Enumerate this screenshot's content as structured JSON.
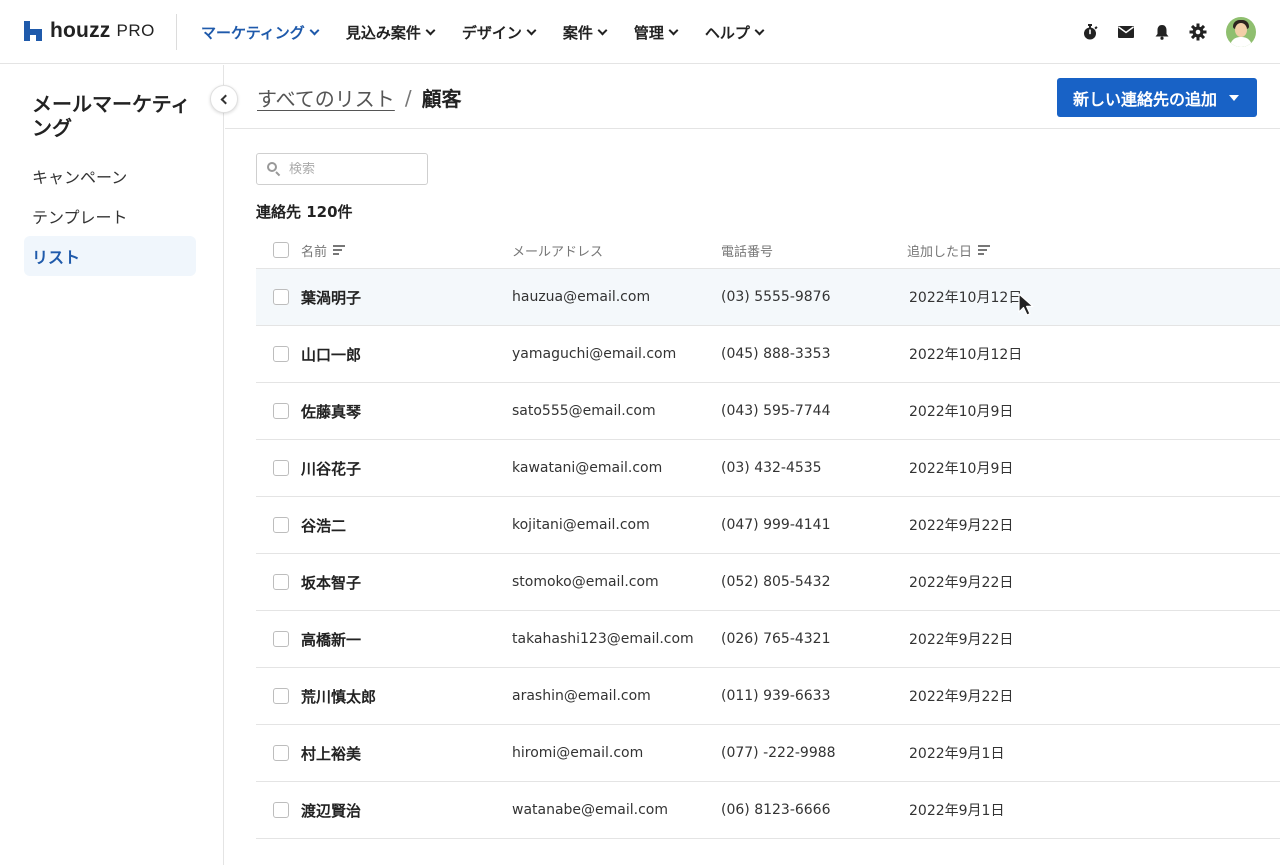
{
  "nav": {
    "logo_word": "houzz",
    "logo_pro": "PRO",
    "items": [
      {
        "label": "マーケティング",
        "active": true
      },
      {
        "label": "見込み案件",
        "active": false
      },
      {
        "label": "デザイン",
        "active": false
      },
      {
        "label": "案件",
        "active": false
      },
      {
        "label": "管理",
        "active": false
      },
      {
        "label": "ヘルプ",
        "active": false
      }
    ],
    "icons": [
      "stopwatch-icon",
      "mail-icon",
      "bell-icon",
      "gear-icon"
    ]
  },
  "sidebar": {
    "title": "メールマーケティング",
    "items": [
      {
        "label": "キャンペーン"
      },
      {
        "label": "テンプレート"
      },
      {
        "label": "リスト"
      }
    ]
  },
  "header": {
    "crumb_parent": "すべてのリスト",
    "crumb_sep": "/",
    "crumb_current": "顧客",
    "add_button": "新しい連絡先の追加"
  },
  "search": {
    "placeholder": "検索"
  },
  "contacts": {
    "count_label": "連絡先 120件",
    "columns": {
      "name": "名前",
      "email": "メールアドレス",
      "phone": "電話番号",
      "date": "追加した日"
    },
    "rows": [
      {
        "name": "葉渦明子",
        "email": "hauzua@email.com",
        "phone": "(03) 5555-9876",
        "date": "2022年10月12日"
      },
      {
        "name": "山口一郎",
        "email": "yamaguchi@email.com",
        "phone": "(045) 888-3353",
        "date": "2022年10月12日"
      },
      {
        "name": "佐藤真琴",
        "email": "sato555@email.com",
        "phone": "(043) 595-7744",
        "date": "2022年10月9日"
      },
      {
        "name": "川谷花子",
        "email": "kawatani@email.com",
        "phone": "(03) 432-4535",
        "date": "2022年10月9日"
      },
      {
        "name": "谷浩二",
        "email": "kojitani@email.com",
        "phone": "(047) 999-4141",
        "date": "2022年9月22日"
      },
      {
        "name": "坂本智子",
        "email": "stomoko@email.com",
        "phone": "(052) 805-5432",
        "date": "2022年9月22日"
      },
      {
        "name": "高橋新一",
        "email": "takahashi123@email.com",
        "phone": "(026) 765-4321",
        "date": "2022年9月22日"
      },
      {
        "name": "荒川慎太郎",
        "email": "arashin@email.com",
        "phone": "(011) 939-6633",
        "date": "2022年9月22日"
      },
      {
        "name": "村上裕美",
        "email": "hiromi@email.com",
        "phone": "(077) -222-9988",
        "date": "2022年9月1日"
      },
      {
        "name": "渡辺賢治",
        "email": "watanabe@email.com",
        "phone": "(06) 8123-6666",
        "date": "2022年9月1日"
      }
    ]
  },
  "colors": {
    "brand": "#1f5aab",
    "button": "#1862c6",
    "row_highlight": "#f4f8fb"
  }
}
